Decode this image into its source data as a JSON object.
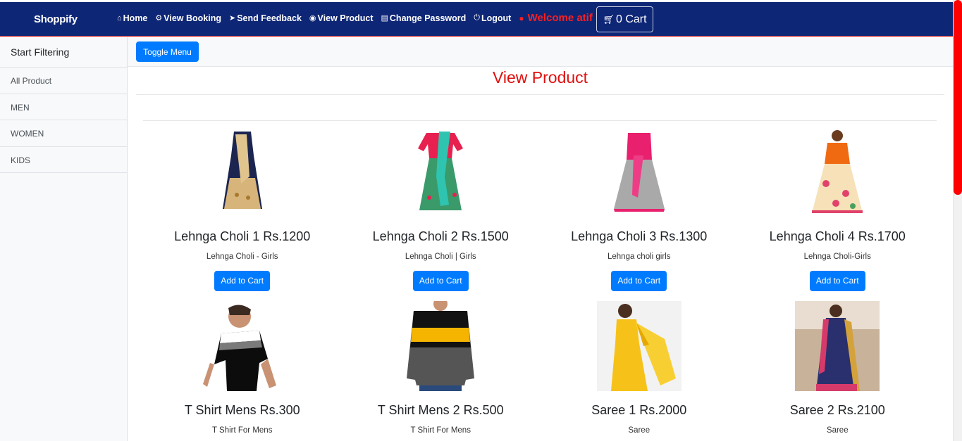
{
  "header": {
    "brand": "Shoppify",
    "nav": [
      {
        "icon": "home-icon",
        "glyph": "⌂",
        "label": "Home"
      },
      {
        "icon": "booking-icon",
        "glyph": "⚙",
        "label": "View Booking"
      },
      {
        "icon": "send-icon",
        "glyph": "➤",
        "label": "Send Feedback"
      },
      {
        "icon": "eye-icon",
        "glyph": "◉",
        "label": "View Product"
      },
      {
        "icon": "document-icon",
        "glyph": "▤",
        "label": "Change Password"
      },
      {
        "icon": "power-icon",
        "glyph": "⏻",
        "label": "Logout"
      }
    ],
    "welcome": "Welcome atif",
    "cart_label": "0 Cart"
  },
  "sidebar": {
    "heading": "Start Filtering",
    "items": [
      {
        "label": "All Product"
      },
      {
        "label": "MEN"
      },
      {
        "label": "WOMEN"
      },
      {
        "label": "KIDS"
      }
    ]
  },
  "main": {
    "toggle_label": "Toggle Menu",
    "title": "View Product",
    "add_label": "Add to Cart",
    "products": [
      {
        "name": "Lehnga Choli 1 Rs.1200",
        "desc": "Lehnga Choli - Girls",
        "image": "dress-icon"
      },
      {
        "name": "Lehnga Choli 2 Rs.1500",
        "desc": "Lehnga Choli | Girls",
        "image": "dress-icon"
      },
      {
        "name": "Lehnga Choli 3 Rs.1300",
        "desc": "Lehnga choli girls",
        "image": "dress-icon"
      },
      {
        "name": "Lehnga Choli 4 Rs.1700",
        "desc": "Lehnga Choli-Girls",
        "image": "dress-icon"
      },
      {
        "name": "T Shirt Mens Rs.300",
        "desc": "T Shirt For Mens",
        "image": "tshirt-icon"
      },
      {
        "name": "T Shirt Mens 2 Rs.500",
        "desc": "T Shirt For Mens",
        "image": "tshirt-icon"
      },
      {
        "name": "Saree 1 Rs.2000",
        "desc": "Saree",
        "image": "saree-icon"
      },
      {
        "name": "Saree 2 Rs.2100",
        "desc": "Saree",
        "image": "saree-icon"
      }
    ]
  },
  "colors": {
    "navbar": "#0e2676",
    "primary": "#007bff",
    "title": "#e00f0f",
    "welcome": "#ff1f1f"
  }
}
